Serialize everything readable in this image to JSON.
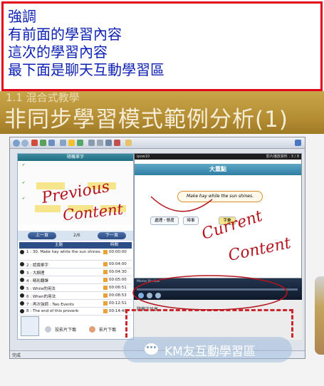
{
  "annotation": {
    "lines": [
      "強調",
      "有前面的學習內容",
      "這次的學習內容",
      "最下面是聊天互動學習區"
    ]
  },
  "slide": {
    "subtitle": "1.1 混合式教學",
    "title": "非同步學習模式範例分析(1)"
  },
  "browser": {
    "status_text": "完成"
  },
  "left_pane": {
    "header": "隨機單字",
    "nav_prev": "上一頁",
    "nav_next": "下一頁",
    "page_indicator": "2/6",
    "table_headers": [
      "主題",
      "時間"
    ],
    "rows": [
      {
        "title": "1 : 30. Make hay while the sun shines.",
        "time": "00:00:00"
      },
      {
        "title": "2 : 認識單字",
        "time": "00:04:00"
      },
      {
        "title": "3 : 大綱理",
        "time": "00:04:30"
      },
      {
        "title": "4 : 精彩翻譯",
        "time": "00:05:00"
      },
      {
        "title": "5 : While的用法",
        "time": "00:06:51"
      },
      {
        "title": "6 : When的用法",
        "time": "00:08:53"
      },
      {
        "title": "7 : 再次強調 : Two Events",
        "time": "00:12:51"
      },
      {
        "title": "8 : The end of this proverb",
        "time": "00:14:40"
      }
    ],
    "footer_labels": [
      "投影片下載",
      "影片下載"
    ]
  },
  "right_pane": {
    "top_left": "ipow10",
    "top_right": "影片播放資料 : 3 / 8",
    "banner": "大重點",
    "proverb": "Make hay while the sun shines.",
    "tags": [
      "處理・態度",
      "時事",
      "字彙"
    ],
    "player_label": "Marno Studios",
    "chat_label": "隨機字共享"
  },
  "handwriting": {
    "previous": [
      "Previous",
      "Content"
    ],
    "current": [
      "Current",
      "Content"
    ]
  },
  "km_button": {
    "label": "KM友互動學習區"
  },
  "colors": {
    "annotation_border": "#e2001a",
    "annotation_text": "#0b1fb3",
    "handwriting": "#b4141d",
    "slide_band": "#b68f35"
  }
}
